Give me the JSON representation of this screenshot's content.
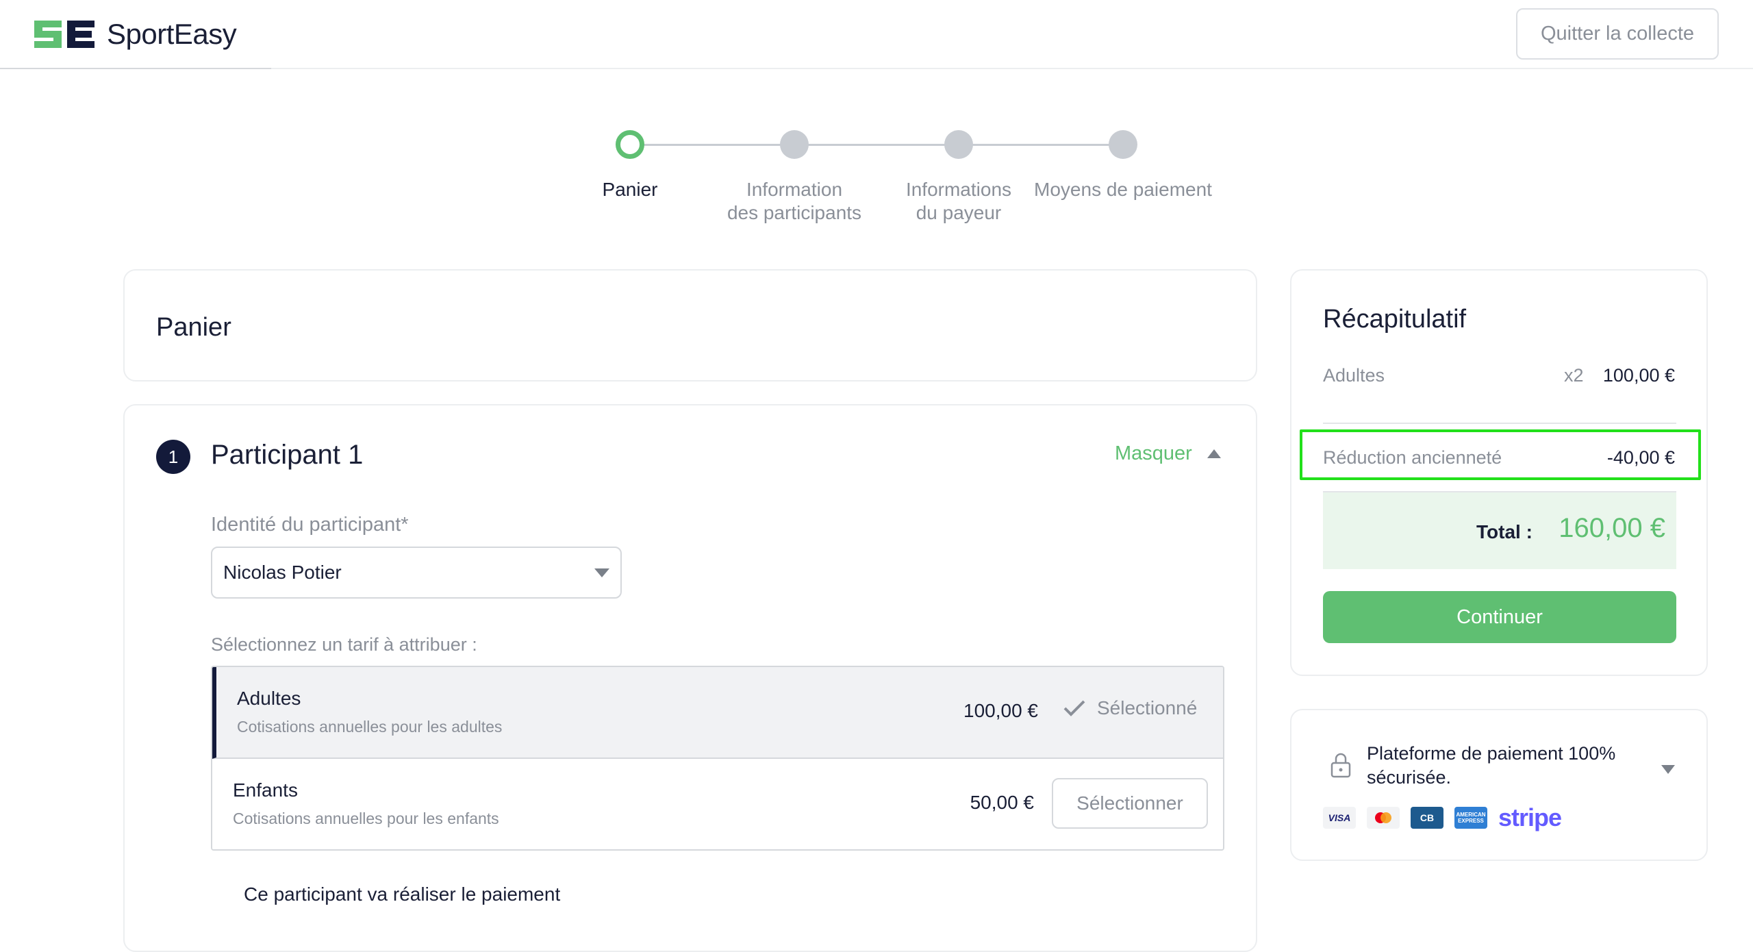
{
  "header": {
    "logo_text": "SportEasy",
    "quit_label": "Quitter la collecte"
  },
  "stepper": {
    "steps": [
      {
        "label_line1": "Panier",
        "label_line2": "",
        "state": "active"
      },
      {
        "label_line1": "Information",
        "label_line2": "des participants",
        "state": "pending"
      },
      {
        "label_line1": "Informations",
        "label_line2": "du payeur",
        "state": "pending"
      },
      {
        "label_line1": "Moyens de paiement",
        "label_line2": "",
        "state": "pending"
      }
    ]
  },
  "panier": {
    "title": "Panier"
  },
  "participant": {
    "number": "1",
    "title": "Participant 1",
    "toggle_label": "Masquer",
    "identity_label": "Identité du participant*",
    "identity_value": "Nicolas Potier",
    "tarif_prompt": "Sélectionnez un tarif à attribuer :",
    "tarifs": [
      {
        "name": "Adultes",
        "description": "Cotisations annuelles pour les adultes",
        "price": "100,00 €",
        "status": "Sélectionné"
      },
      {
        "name": "Enfants",
        "description": "Cotisations annuelles pour les enfants",
        "price": "50,00 €",
        "action": "Sélectionner"
      }
    ],
    "payer_note": "Ce participant va réaliser le paiement"
  },
  "summary": {
    "title": "Récapitulatif",
    "line_label": "Adultes",
    "line_qty": "x2",
    "line_amount": "100,00 €",
    "discount_label": "Réduction ancienneté",
    "discount_amount": "-40,00 €",
    "total_label": "Total :",
    "total_value": "160,00 €",
    "continue_label": "Continuer"
  },
  "security": {
    "text": "Plateforme de paiement 100% sécurisée.",
    "methods": [
      "VISA",
      "Mastercard",
      "CB",
      "AMERICAN EXPRESS",
      "stripe"
    ]
  },
  "colors": {
    "accent_green": "#5fbf72",
    "navy": "#131a3a",
    "highlight": "#22e01a"
  }
}
